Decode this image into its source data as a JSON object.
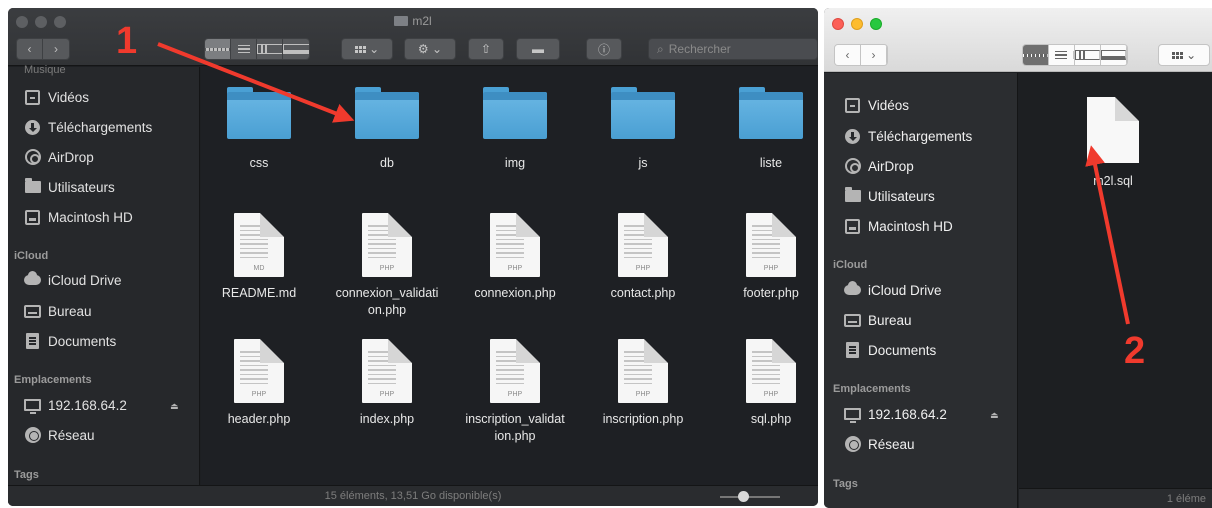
{
  "window_left": {
    "title": "m2l",
    "search_placeholder": "Rechercher",
    "sidebar": {
      "partial_top": "Musique",
      "favorites": [
        "Vidéos",
        "Téléchargements",
        "AirDrop",
        "Utilisateurs",
        "Macintosh HD"
      ],
      "icloud_header": "iCloud",
      "icloud": [
        "iCloud Drive",
        "Bureau",
        "Documents"
      ],
      "locations_header": "Emplacements",
      "locations": [
        "192.168.64.2",
        "Réseau"
      ],
      "tags_header": "Tags"
    },
    "folders": [
      "css",
      "db",
      "img",
      "js",
      "liste"
    ],
    "files_row1": [
      {
        "name": "README.md",
        "ext": "MD"
      },
      {
        "name": "connexion_validati\non.php",
        "ext": "PHP"
      },
      {
        "name": "connexion.php",
        "ext": "PHP"
      },
      {
        "name": "contact.php",
        "ext": "PHP"
      },
      {
        "name": "footer.php",
        "ext": "PHP"
      }
    ],
    "files_row2": [
      {
        "name": "header.php",
        "ext": "PHP"
      },
      {
        "name": "index.php",
        "ext": "PHP"
      },
      {
        "name": "inscription_validat\nion.php",
        "ext": "PHP"
      },
      {
        "name": "inscription.php",
        "ext": "PHP"
      },
      {
        "name": "sql.php",
        "ext": "PHP"
      }
    ],
    "status": "15 éléments, 13,51 Go disponible(s)"
  },
  "window_right": {
    "sidebar": {
      "favorites": [
        "Vidéos",
        "Téléchargements",
        "AirDrop",
        "Utilisateurs",
        "Macintosh HD"
      ],
      "icloud_header": "iCloud",
      "icloud": [
        "iCloud Drive",
        "Bureau",
        "Documents"
      ],
      "locations_header": "Emplacements",
      "locations": [
        "192.168.64.2",
        "Réseau"
      ],
      "tags_header": "Tags"
    },
    "file": {
      "name": "m2l.sql"
    },
    "status": "1 éléme"
  },
  "annotations": {
    "label_1": "1",
    "label_2": "2",
    "color": "#f03a2d"
  }
}
